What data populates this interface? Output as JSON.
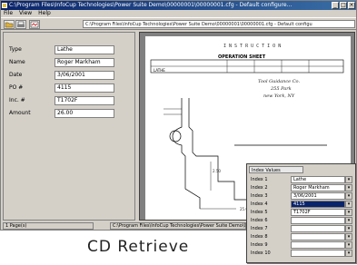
{
  "window": {
    "title": "C:\\Program Files\\InfoCup Technologies\\Power Suite Demo\\00000001\\00000001.cfg - Default configure...",
    "controls": [
      "_",
      "□",
      "×"
    ]
  },
  "menu": [
    "File",
    "View",
    "Help"
  ],
  "toolbar": {
    "path": "C:\\Program Files\\InfoCup Technologies\\Power Suite Demo\\00000001\\00000001.cfg - Default configu"
  },
  "fields": [
    {
      "label": "Type",
      "value": "Lathe"
    },
    {
      "label": "Name",
      "value": "Roger Markham"
    },
    {
      "label": "Date",
      "value": "3/06/2001"
    },
    {
      "label": "PO #",
      "value": "4115"
    },
    {
      "label": "Inc. #",
      "value": "T1702F"
    },
    {
      "label": "Amount",
      "value": "26.00"
    }
  ],
  "document": {
    "header": "I N S T R U C T I O N",
    "sheet_title": "OPERATION SHEET",
    "row_label": "LATHE",
    "company": "Tool Guidance Co.",
    "company_line2": "255 Park",
    "company_line3": "new York, NY"
  },
  "status": {
    "left": "1 Page(s)",
    "right": "C:\\Program Files\\InfoCup Technologies\\Power Suite Demo\\00000001"
  },
  "index_window": {
    "title": "Index Values",
    "rows": [
      {
        "label": "Index 1",
        "value": "Lathe",
        "selected": false
      },
      {
        "label": "Index 2",
        "value": "Roger Markham",
        "selected": false
      },
      {
        "label": "Index 3",
        "value": "3/06/2001",
        "selected": false
      },
      {
        "label": "Index 4",
        "value": "4115",
        "selected": true
      },
      {
        "label": "Index 5",
        "value": "T1702F",
        "selected": false
      },
      {
        "label": "Index 6",
        "value": "",
        "selected": false
      },
      {
        "label": "Index 7",
        "value": "",
        "selected": false
      },
      {
        "label": "Index 8",
        "value": "",
        "selected": false
      },
      {
        "label": "Index 9",
        "value": "",
        "selected": false
      },
      {
        "label": "Index 10",
        "value": "",
        "selected": false
      }
    ]
  },
  "caption": "CD Retrieve",
  "colors": {
    "titlebar": "#0a246a",
    "chrome": "#d4d0c8",
    "selection": "#0a246a"
  }
}
